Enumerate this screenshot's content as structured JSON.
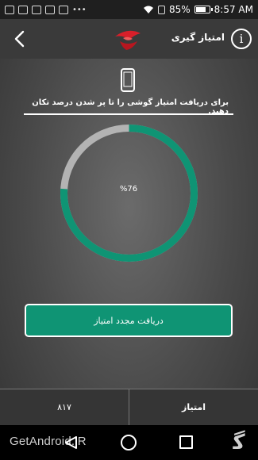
{
  "status_bar": {
    "battery": "85%",
    "battery_level": 0.85,
    "time": "8:57 AM"
  },
  "header": {
    "title": "امتیاز گیری",
    "info_glyph": "i"
  },
  "content": {
    "instruction": "برای دریافت امتیاز گوشی را تا پر شدن درصد تکان دهید.",
    "progress_percent": 76,
    "progress_label": "%76",
    "progress_color": "#0f9474",
    "track_color": "#b3b3b3"
  },
  "refresh_button": {
    "label": "دریافت مجدد امتیاز"
  },
  "bottom_bar": {
    "score_value": "۸۱۷",
    "score_label": "امتیاز"
  },
  "watermark": {
    "text": "GetAndroid.iR"
  },
  "icons": [
    "back-arrow-icon",
    "logo-icon",
    "info-icon",
    "phone-icon",
    "nav-back-icon",
    "nav-home-icon",
    "nav-recent-icon"
  ]
}
